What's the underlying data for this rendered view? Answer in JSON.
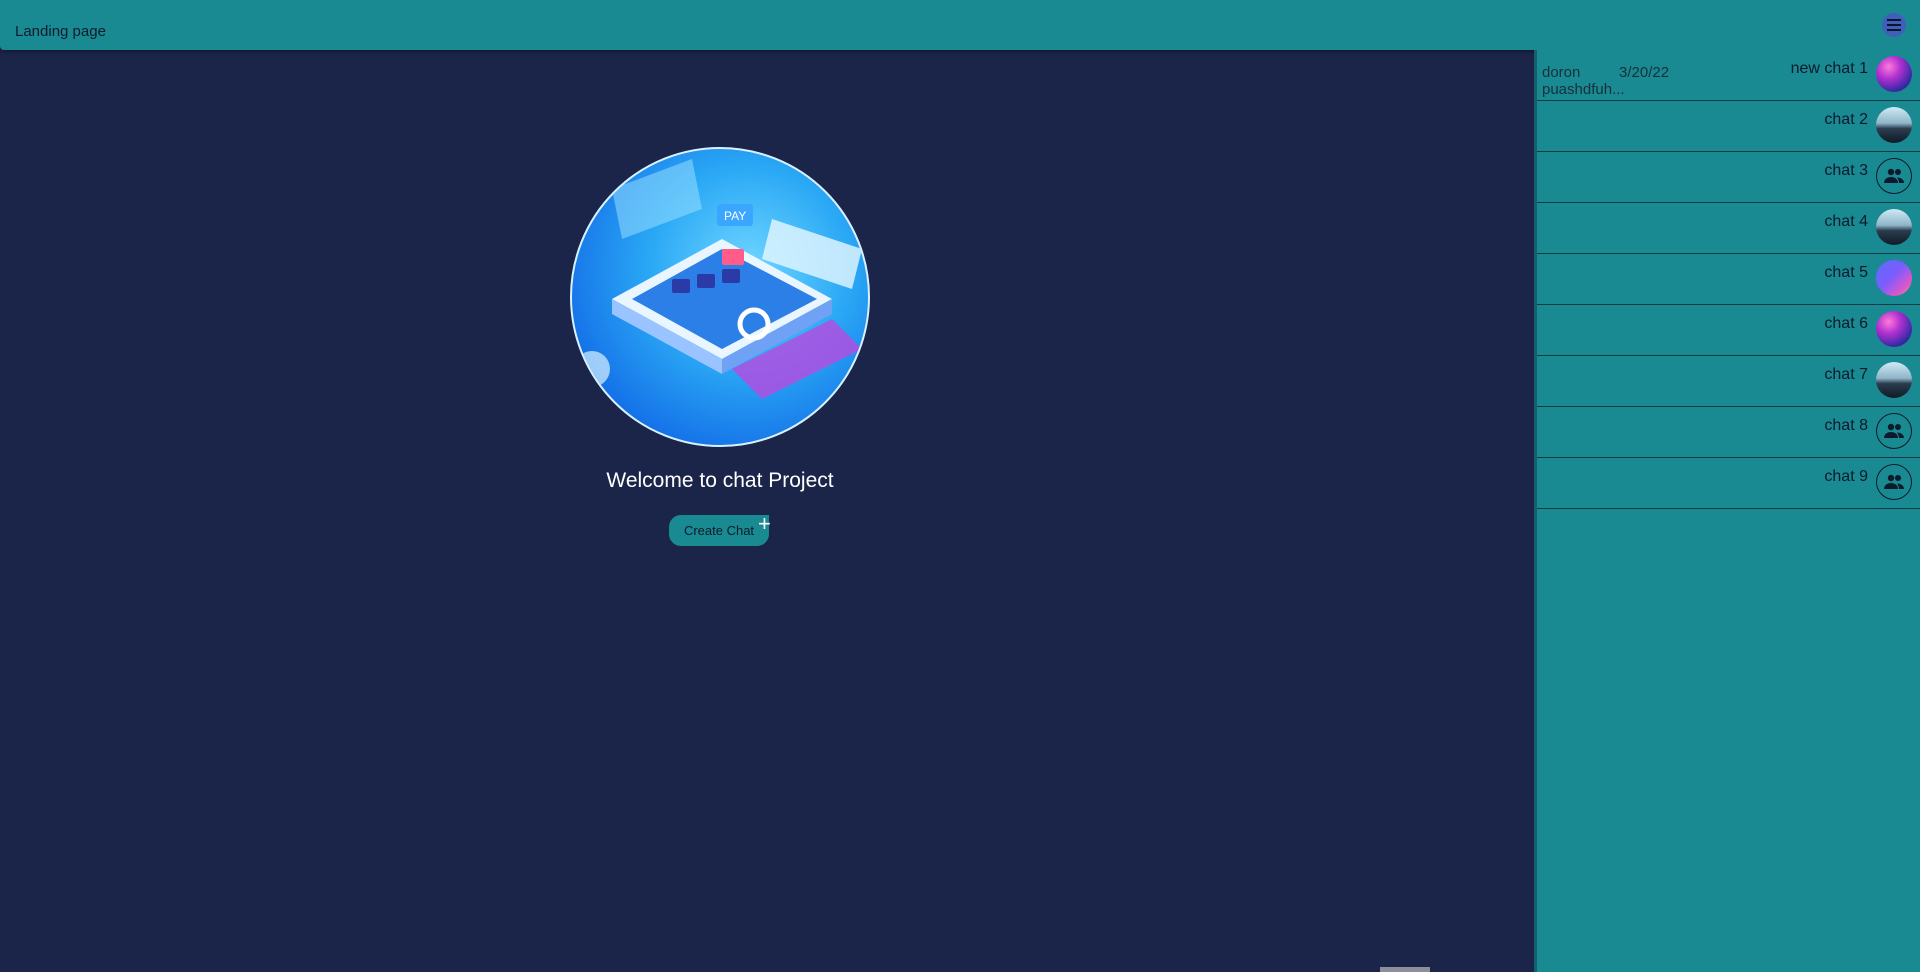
{
  "header": {
    "title": "Landing page"
  },
  "main": {
    "welcome_text": "Welcome to chat Project",
    "create_chat_label": "Create Chat",
    "create_chat_icon": "plus-icon"
  },
  "sidebar": {
    "chats": [
      {
        "name": "new chat 1",
        "sender": "doron",
        "date": "3/20/22",
        "preview": "puashdfuh...",
        "avatar": "planet-avatar"
      },
      {
        "name": "chat 2",
        "avatar": "mountain-avatar"
      },
      {
        "name": "chat 3",
        "avatar": "group-icon"
      },
      {
        "name": "chat 4",
        "avatar": "mountain-avatar"
      },
      {
        "name": "chat 5",
        "avatar": "abstract-avatar"
      },
      {
        "name": "chat 6",
        "avatar": "planet-avatar"
      },
      {
        "name": "chat 7",
        "avatar": "mountain-avatar"
      },
      {
        "name": "chat 8",
        "avatar": "group-icon"
      },
      {
        "name": "chat 9",
        "avatar": "group-icon"
      }
    ]
  },
  "colors": {
    "background": "#1b2549",
    "accent": "#1a8a92",
    "menu_button": "#3f5fb8"
  }
}
